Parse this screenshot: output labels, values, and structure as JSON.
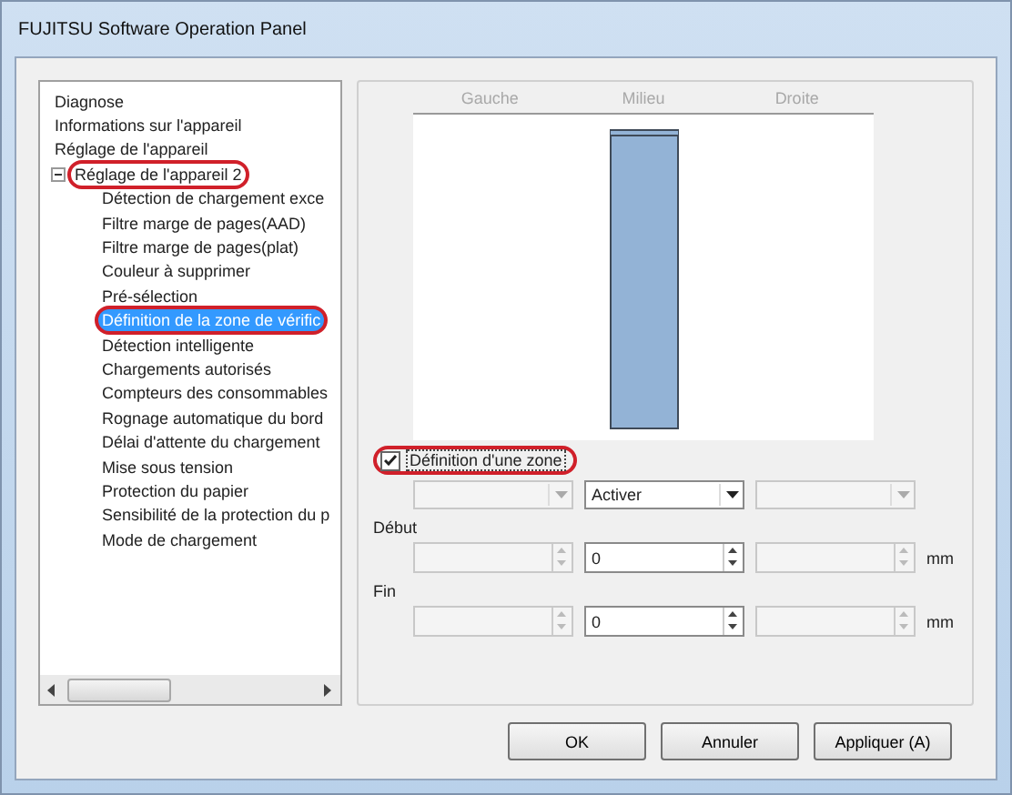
{
  "window": {
    "title": "FUJITSU Software Operation Panel"
  },
  "tree": [
    {
      "label": "Diagnose",
      "selected": false,
      "highlighted": false
    },
    {
      "label": "Informations sur l'appareil",
      "selected": false,
      "highlighted": false
    },
    {
      "label": "Réglage de l'appareil",
      "selected": false,
      "highlighted": false
    },
    {
      "label": "Réglage de l'appareil 2",
      "selected": false,
      "highlighted": true,
      "expanded": true,
      "children": [
        {
          "label": "Détection de chargement exce",
          "selected": false,
          "highlighted": false
        },
        {
          "label": "Filtre marge de pages(AAD)",
          "selected": false,
          "highlighted": false
        },
        {
          "label": "Filtre marge de pages(plat)",
          "selected": false,
          "highlighted": false
        },
        {
          "label": "Couleur à supprimer",
          "selected": false,
          "highlighted": false
        },
        {
          "label": "Pré-sélection",
          "selected": false,
          "highlighted": false
        },
        {
          "label": "Définition de la zone de vérific",
          "selected": true,
          "highlighted": true
        },
        {
          "label": "Détection intelligente",
          "selected": false,
          "highlighted": false
        },
        {
          "label": "Chargements autorisés",
          "selected": false,
          "highlighted": false
        },
        {
          "label": "Compteurs des consommables",
          "selected": false,
          "highlighted": false
        },
        {
          "label": "Rognage automatique du bord",
          "selected": false,
          "highlighted": false
        },
        {
          "label": "Délai d'attente du chargement",
          "selected": false,
          "highlighted": false
        },
        {
          "label": "Mise sous tension",
          "selected": false,
          "highlighted": false
        },
        {
          "label": "Protection du papier",
          "selected": false,
          "highlighted": false
        },
        {
          "label": "Sensibilité de la protection du p",
          "selected": false,
          "highlighted": false
        },
        {
          "label": "Mode de chargement",
          "selected": false,
          "highlighted": false
        }
      ]
    }
  ],
  "preview": {
    "columns": [
      {
        "label": "Gauche",
        "zone": false
      },
      {
        "label": "Milieu",
        "zone": true
      },
      {
        "label": "Droite",
        "zone": false
      }
    ]
  },
  "zone_checkbox": {
    "label": "Définition d'une zone",
    "checked": true,
    "highlighted": true
  },
  "selectors": [
    {
      "disabled": true
    },
    {
      "value": "Activer",
      "disabled": false
    },
    {
      "disabled": true
    }
  ],
  "ranges": [
    {
      "label": "Début",
      "unit": "mm",
      "fields": [
        {
          "disabled": true
        },
        {
          "value": "0",
          "disabled": false
        },
        {
          "disabled": true
        }
      ]
    },
    {
      "label": "Fin",
      "unit": "mm",
      "fields": [
        {
          "disabled": true
        },
        {
          "value": "0",
          "disabled": false
        },
        {
          "disabled": true
        }
      ]
    }
  ],
  "buttons": [
    "OK",
    "Annuler",
    "Appliquer (A)"
  ]
}
